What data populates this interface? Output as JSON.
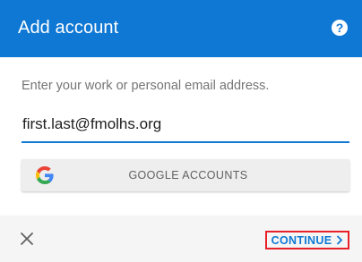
{
  "header": {
    "title": "Add account",
    "help_icon": "help-icon",
    "help_glyph": "?",
    "background": "#0f78d4"
  },
  "form": {
    "instruction": "Enter your work or personal email address.",
    "email_value": "first.last@fmolhs.org",
    "google_button_label": "GOOGLE ACCOUNTS",
    "google_icon": "google-logo-icon"
  },
  "footer": {
    "close_icon": "close-icon",
    "continue_label": "CONTINUE",
    "continue_icon": "chevron-right-icon",
    "highlight_color": "#e8202a"
  }
}
